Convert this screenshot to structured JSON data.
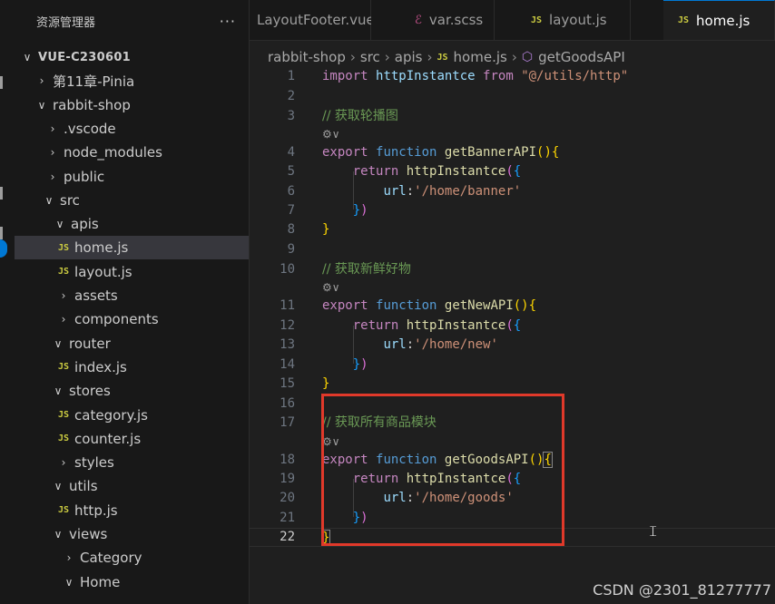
{
  "explorer": {
    "title": "资源管理器",
    "more": "···",
    "items": [
      {
        "label": "VUE-C230601",
        "chev": "∨",
        "root": true
      },
      {
        "label": "第11章-Pinia",
        "chev": "›"
      },
      {
        "label": "rabbit-shop",
        "chev": "∨"
      },
      {
        "label": ".vscode",
        "chev": "›"
      },
      {
        "label": "node_modules",
        "chev": "›"
      },
      {
        "label": "public",
        "chev": "›"
      },
      {
        "label": "src",
        "chev": "∨"
      },
      {
        "label": "apis",
        "chev": "∨"
      },
      {
        "label": "home.js",
        "js": "JS",
        "selected": true
      },
      {
        "label": "layout.js",
        "js": "JS"
      },
      {
        "label": "assets",
        "chev": "›"
      },
      {
        "label": "components",
        "chev": "›"
      },
      {
        "label": "router",
        "chev": "∨"
      },
      {
        "label": "index.js",
        "js": "JS"
      },
      {
        "label": "stores",
        "chev": "∨"
      },
      {
        "label": "category.js",
        "js": "JS"
      },
      {
        "label": "counter.js",
        "js": "JS"
      },
      {
        "label": "styles",
        "chev": "›"
      },
      {
        "label": "utils",
        "chev": "∨"
      },
      {
        "label": "http.js",
        "js": "JS"
      },
      {
        "label": "views",
        "chev": "∨"
      },
      {
        "label": "Category",
        "chev": "›"
      },
      {
        "label": "Home",
        "chev": "∨"
      }
    ]
  },
  "tabs": [
    {
      "label": "LayoutFooter.vue",
      "icon": "vue"
    },
    {
      "label": "var.scss",
      "icon": "scss"
    },
    {
      "label": "layout.js",
      "icon": "JS"
    },
    {
      "label": "home.js",
      "icon": "JS",
      "active": true
    }
  ],
  "breadcrumb": [
    "rabbit-shop",
    "src",
    "apis",
    "home.js",
    "getGoodsAPI"
  ],
  "breadcrumb_js": "JS",
  "editor": {
    "current_line": 22,
    "line_numbers": [
      "1",
      "2",
      "3",
      "4",
      "5",
      "6",
      "7",
      "8",
      "9",
      "10",
      "11",
      "12",
      "13",
      "14",
      "15",
      "16",
      "17",
      "18",
      "19",
      "20",
      "21",
      "22"
    ],
    "lens_glyph": "⚙∨",
    "code": {
      "import_kw": "import",
      "import_name": "httpInstantce",
      "from_kw": "from",
      "import_path": "\"@/utils/http\"",
      "c1": "// 获取轮播图",
      "c2": "// 获取新鲜好物",
      "c3": "// 获取所有商品模块",
      "export_kw": "export",
      "function_kw": "function",
      "fn1": "getBannerAPI",
      "fn2": "getNewAPI",
      "fn3": "getGoodsAPI",
      "return_kw": "return",
      "call": "httpInstantce",
      "url_key": "url",
      "url1": "'/home/banner'",
      "url2": "'/home/new'",
      "url3": "'/home/goods'"
    }
  },
  "watermark": "CSDN @2301_81277777",
  "colors": {
    "accent": "#0078d4",
    "highlight_box": "#e0392a",
    "js_icon": "#cbcb41"
  }
}
